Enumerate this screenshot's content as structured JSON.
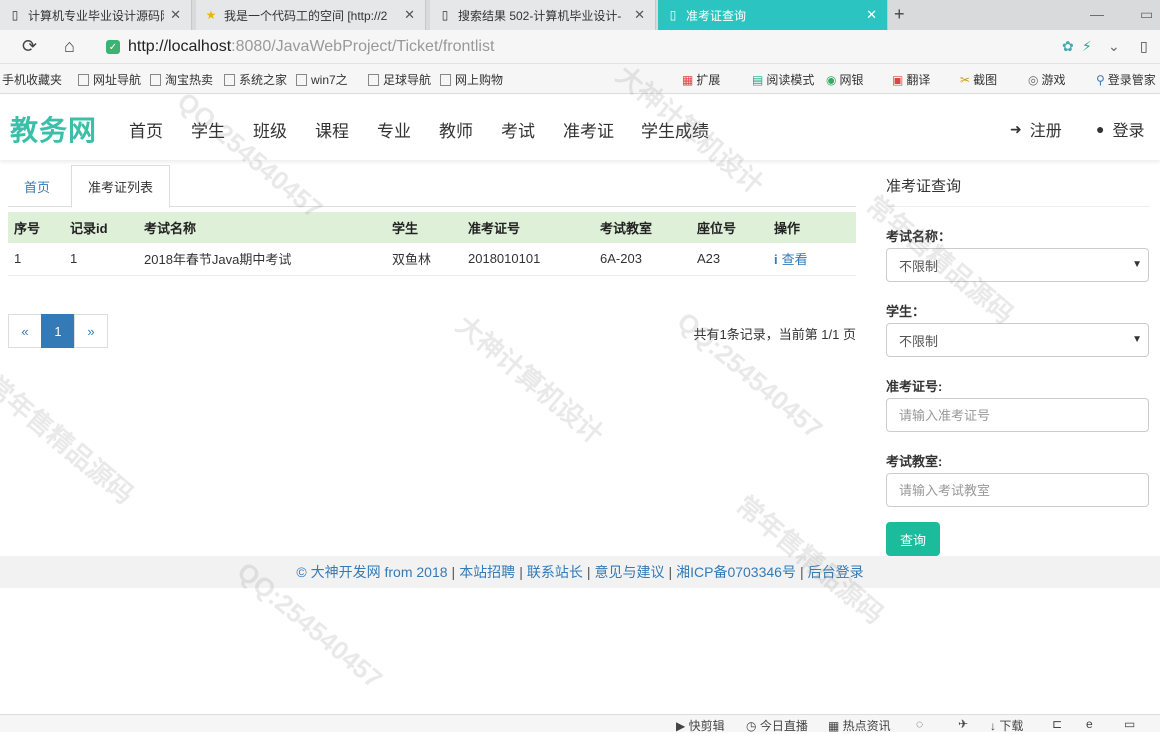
{
  "browser": {
    "tabs": [
      {
        "label": "计算机专业毕业设计源码网",
        "icon": "page-icon",
        "active": false
      },
      {
        "label": "我是一个代码工的空间 [http://2",
        "icon": "star-icon",
        "active": false
      },
      {
        "label": "搜索结果 502-计算机毕业设计-",
        "icon": "page-icon",
        "active": false
      },
      {
        "label": "准考证查询",
        "icon": "page-icon",
        "active": true
      }
    ],
    "url_host": "http://localhost",
    "url_rest": ":8080/JavaWebProject/Ticket/frontlist",
    "bookmarks": [
      "手机收藏夹",
      "网址导航",
      "淘宝热卖",
      "系统之家",
      "win7之",
      "足球导航",
      "网上购物"
    ],
    "toolbar_right": [
      "扩展",
      "阅读模式",
      "网银",
      "翻译",
      "截图",
      "游戏",
      "登录管家"
    ]
  },
  "site": {
    "brand": "教务网",
    "menu": [
      "首页",
      "学生",
      "班级",
      "课程",
      "专业",
      "教师",
      "考试",
      "准考证",
      "学生成绩"
    ],
    "register": "注册",
    "login": "登录"
  },
  "main": {
    "tabs": [
      "首页",
      "准考证列表"
    ],
    "columns": [
      "序号",
      "记录id",
      "考试名称",
      "学生",
      "准考证号",
      "考试教室",
      "座位号",
      "操作"
    ],
    "rows": [
      {
        "no": "1",
        "id": "1",
        "exam": "2018年春节Java期中考试",
        "student": "双鱼林",
        "ticket": "2018010101",
        "room": "6A-203",
        "seat": "A23",
        "action": "查看"
      }
    ],
    "pager": {
      "prev": "«",
      "current": "1",
      "next": "»"
    },
    "summary": "共有1条记录，当前第 1/1 页"
  },
  "sidebar": {
    "title": "准考证查询",
    "exam_label": "考试名称：",
    "exam_value": "不限制",
    "student_label": "学生：",
    "student_value": "不限制",
    "ticket_label": "准考证号:",
    "ticket_placeholder": "请输入准考证号",
    "room_label": "考试教室:",
    "room_placeholder": "请输入考试教室",
    "query_button": "查询"
  },
  "footer": {
    "links": [
      "© 大神开发网 from 2018",
      "本站招聘",
      "联系站长",
      "意见与建议",
      "湘ICP备0703346号",
      "后台登录"
    ]
  },
  "statusbar": [
    "快剪辑",
    "今日直播",
    "热点资讯",
    "下载"
  ],
  "watermarks": [
    "大神计算机设计",
    "QQ:254540457",
    "常年售精品源码"
  ]
}
